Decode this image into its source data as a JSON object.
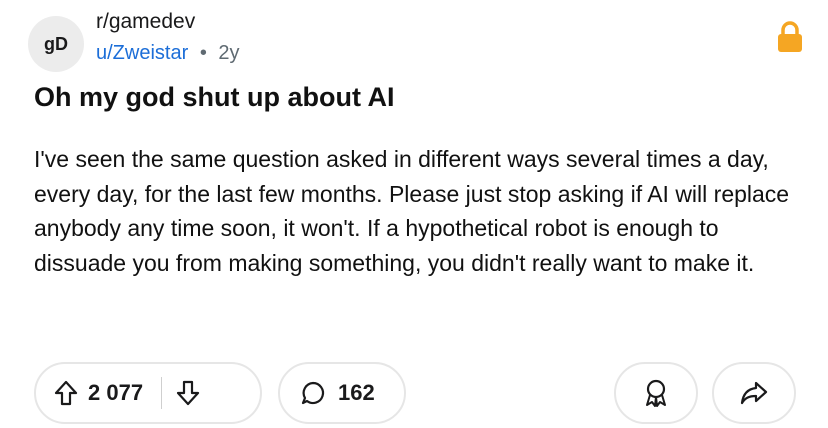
{
  "header": {
    "avatar_text": "gD",
    "subreddit": "r/gamedev",
    "username": "u/Zweistar",
    "separator": "•",
    "age": "2y",
    "lock_color": "#f5a623"
  },
  "post": {
    "title": "Oh my god shut up about AI",
    "body": "I've seen the same question asked in different ways several times a day, every day, for the last few months. Please just stop asking if AI will replace anybody any time soon, it won't. If a hypothetical robot is enough to dissuade you from making something, you didn't really want to make it."
  },
  "actions": {
    "upvote_count": "2 077",
    "comment_count": "162",
    "icons": [
      "upvote-icon",
      "downvote-icon",
      "comment-icon",
      "award-icon",
      "share-icon"
    ]
  }
}
